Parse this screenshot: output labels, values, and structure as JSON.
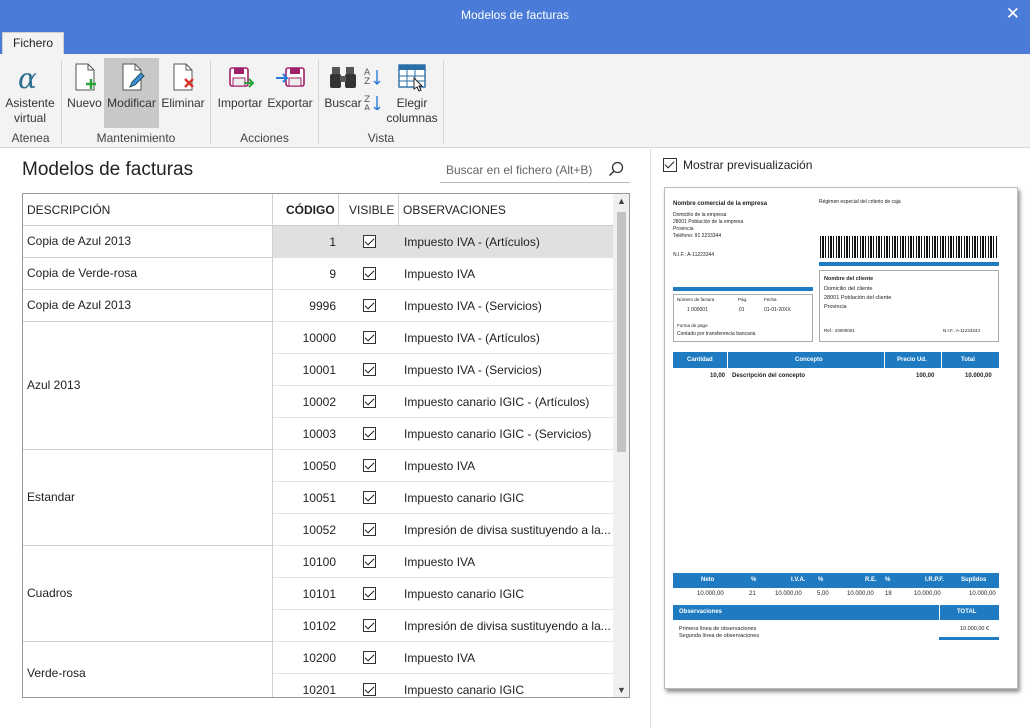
{
  "window": {
    "title": "Modelos de facturas"
  },
  "tab": "Fichero",
  "ribbon": {
    "groups": {
      "atenea": "Atenea",
      "mantenimiento": "Mantenimiento",
      "acciones": "Acciones",
      "vista": "Vista"
    },
    "buttons": {
      "asistente_line1": "Asistente",
      "asistente_line2": "virtual",
      "nuevo": "Nuevo",
      "modificar": "Modificar",
      "eliminar": "Eliminar",
      "importar": "Importar",
      "exportar": "Exportar",
      "buscar": "Buscar",
      "elegir_line1": "Elegir",
      "elegir_line2": "columnas"
    }
  },
  "main": {
    "heading": "Modelos de facturas",
    "search_placeholder": "Buscar en el fichero (Alt+B)"
  },
  "table": {
    "headers": {
      "descripcion": "DESCRIPCIÓN",
      "codigo": "CÓDIGO",
      "visible": "VISIBLE",
      "observaciones": "OBSERVACIONES"
    },
    "groups": [
      {
        "label": "Copia de Azul 2013",
        "rows": 1
      },
      {
        "label": "Copia de Verde-rosa",
        "rows": 1
      },
      {
        "label": "Copia de Azul 2013",
        "rows": 1
      },
      {
        "label": "Azul 2013",
        "rows": 4
      },
      {
        "label": "Estandar",
        "rows": 3
      },
      {
        "label": "Cuadros",
        "rows": 3
      },
      {
        "label": "Verde-rosa",
        "rows": 2
      }
    ],
    "rows": [
      {
        "codigo": "1",
        "visible": true,
        "observaciones": "Impuesto IVA - (Artículos)"
      },
      {
        "codigo": "9",
        "visible": true,
        "observaciones": "Impuesto IVA"
      },
      {
        "codigo": "9996",
        "visible": true,
        "observaciones": "Impuesto IVA - (Servicios)"
      },
      {
        "codigo": "10000",
        "visible": true,
        "observaciones": "Impuesto IVA - (Artículos)"
      },
      {
        "codigo": "10001",
        "visible": true,
        "observaciones": "Impuesto IVA - (Servicios)"
      },
      {
        "codigo": "10002",
        "visible": true,
        "observaciones": "Impuesto canario IGIC - (Artículos)"
      },
      {
        "codigo": "10003",
        "visible": true,
        "observaciones": "Impuesto canario IGIC - (Servicios)"
      },
      {
        "codigo": "10050",
        "visible": true,
        "observaciones": "Impuesto IVA"
      },
      {
        "codigo": "10051",
        "visible": true,
        "observaciones": "Impuesto canario IGIC"
      },
      {
        "codigo": "10052",
        "visible": true,
        "observaciones": "Impresión de divisa sustituyendo a la..."
      },
      {
        "codigo": "10100",
        "visible": true,
        "observaciones": "Impuesto IVA"
      },
      {
        "codigo": "10101",
        "visible": true,
        "observaciones": "Impuesto canario IGIC"
      },
      {
        "codigo": "10102",
        "visible": true,
        "observaciones": "Impresión de divisa sustituyendo a la..."
      },
      {
        "codigo": "10200",
        "visible": true,
        "observaciones": "Impuesto IVA"
      },
      {
        "codigo": "10201",
        "visible": true,
        "observaciones": "Impuesto canario IGIC"
      }
    ]
  },
  "preview": {
    "toggle_label": "Mostrar previsualización",
    "doc": {
      "company_name": "Nombre comercial de la empresa",
      "regime": "Régimen especial del criterio de caja",
      "company_addr1": "Domicilio de la empresa",
      "company_addr2": "28001   Población de la empresa",
      "company_addr3": "Provincia",
      "company_phone": "Teléfono:   91 2233344",
      "company_nif": "N.I.F.:  A-11223344",
      "invoice_num_label": "Número de factura",
      "page_label": "Pág.",
      "date_label": "Fecha",
      "invoice_num": "1 000001",
      "page": "01",
      "date": "01-01-20XX",
      "payment_label": "Forma de pago",
      "payment": "Contado por transferencia bancaria",
      "client_name": "Nombre del cliente",
      "client_addr1": "Domicilio del cliente",
      "client_addr2": "28001 Población del cliente",
      "client_addr3": "Provincia",
      "ref": "Ref.:  43000001",
      "client_nif": "N.I.F.:  A-11223344",
      "col_cantidad": "Cantidad",
      "col_concepto": "Concepto",
      "col_precio": "Precio Ud.",
      "col_total": "Total",
      "line_qty": "10,00",
      "line_concept": "Descripción del concepto",
      "line_price": "100,00",
      "line_total": "10.000,00",
      "t_neto": "Neto",
      "t_pct": "%",
      "t_iva": "I.V.A.",
      "t_re": "R.E.",
      "t_irpf": "I.R.P.F.",
      "t_suplidos": "Suplidos",
      "v_neto": "10.000,00",
      "v_iva_pct": "21",
      "v_iva": "10.000,00",
      "v_re_pct": "5,00",
      "v_re": "10.000,00",
      "v_irpf_pct": "18",
      "v_irpf": "10.000,00",
      "v_suplidos": "10.000,00",
      "obs_label": "Observaciones",
      "total_label": "TOTAL",
      "obs1": "Primera línea de observaciones",
      "obs2": "Segunda línea de observaciones",
      "total_value": "10.000,00  €"
    }
  },
  "colors": {
    "titlebar": "#4a7bd8",
    "accent": "#1e7bc1"
  }
}
